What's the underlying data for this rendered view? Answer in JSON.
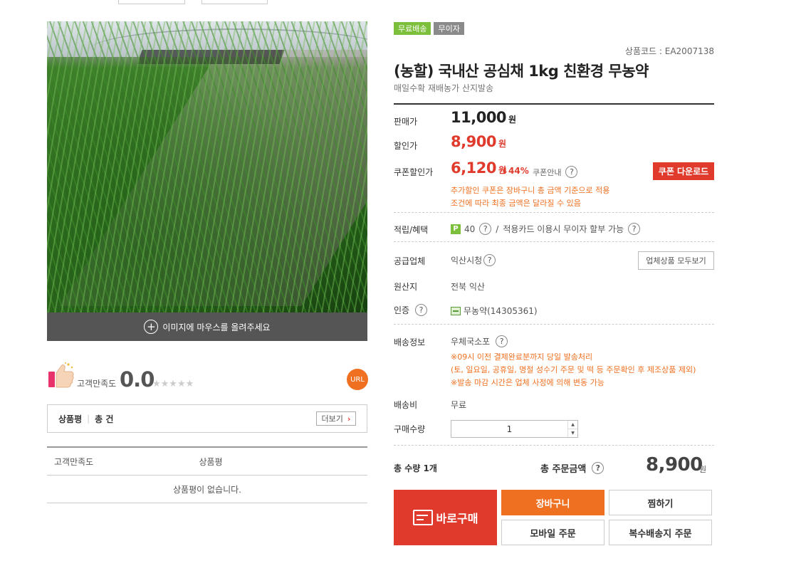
{
  "gallery": {
    "hover_hint": "이미지에 마우스를 올려주세요"
  },
  "satisfaction": {
    "label": "고객만족도",
    "score": "0.0",
    "stars": "★★★★★",
    "url_label": "URL"
  },
  "reviews": {
    "title": "상품평",
    "count_label": "총 건",
    "more_label": "더보기",
    "columns": [
      "고객만족도",
      "상품평"
    ],
    "empty_message": "상품평이 없습니다."
  },
  "product": {
    "badges": [
      "무료배송",
      "무이자"
    ],
    "code": "상품코드 : EA2007138",
    "title": "(농할) 국내산 공심채 1kg 친환경 무농약",
    "subtitle": "매일수확 재배농가 산지발송"
  },
  "pricing": {
    "sale_label": "판매가",
    "sale_price": "11,000",
    "discount_label": "할인가",
    "discount_price": "8,900",
    "coupon_label": "쿠폰할인가",
    "coupon_price": "6,120",
    "currency": "원",
    "rate": "⬇44%",
    "coupon_guide": "쿠폰안내",
    "coupon_download": "쿠폰 다운로드",
    "coupon_notes": [
      "추가할인 쿠폰은 장바구니 총 금액 기준으로 적용",
      "조건에 따라 최종 금액은 달라질 수 있음"
    ]
  },
  "info": {
    "points_label": "적립/혜택",
    "points_value": "40",
    "points_sep": "/",
    "card_text": "적용카드 이용시 무이자 할부 가능",
    "vendor_label": "공급업체",
    "vendor_value": "익산시청",
    "vendor_button": "업체상품 모두보기",
    "origin_label": "원산지",
    "origin_value": "전북 익산",
    "cert_label": "인증",
    "cert_value": "무농약(14305361)",
    "shipping_label": "배송정보",
    "shipping_value": "우체국소포",
    "shipping_notes": [
      "※09시 이전 결제완료분까지 당일 발송처리",
      "(토, 일요일, 공휴일, 명절 성수기 주문 및 떡 등 주문확인 후 제조상품 제외)",
      "※발송 마감 시간은 업체 사정에 의해 변동 가능"
    ],
    "fee_label": "배송비",
    "fee_value": "무료",
    "qty_label": "구매수량",
    "qty_value": "1"
  },
  "total": {
    "qty_text": "총 수량 1개",
    "amount_label": "총 주문금액",
    "amount": "8,900",
    "currency": "원"
  },
  "actions": {
    "buy_now": "바로구매",
    "cart": "장바구니",
    "wishlist": "찜하기",
    "mobile_order": "모바일 주문",
    "multi_ship": "복수배송지 주문"
  }
}
